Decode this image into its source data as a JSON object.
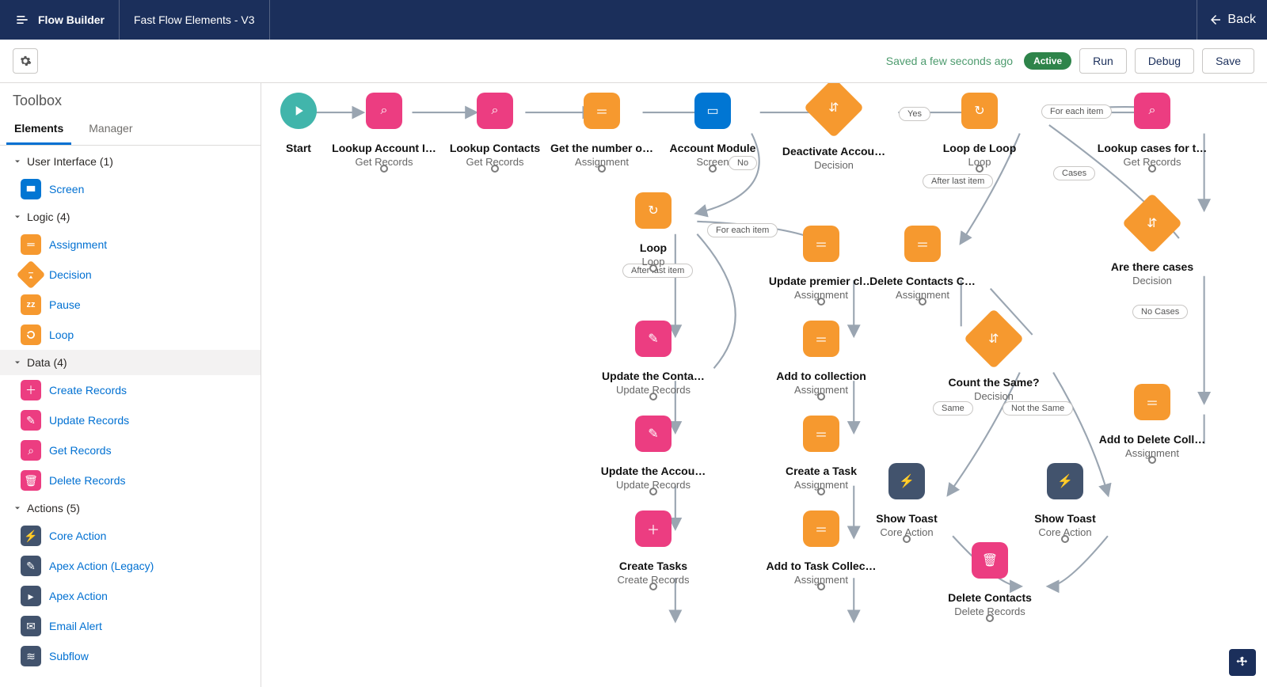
{
  "header": {
    "brand": "Flow Builder",
    "flowName": "Fast Flow Elements - V3",
    "back": "Back"
  },
  "toolbar": {
    "savedText": "Saved a few seconds ago",
    "status": "Active",
    "run": "Run",
    "debug": "Debug",
    "save": "Save"
  },
  "sidebar": {
    "title": "Toolbox",
    "tabs": {
      "elements": "Elements",
      "manager": "Manager"
    },
    "groups": {
      "ui": "User Interface (1)",
      "logic": "Logic (4)",
      "data": "Data (4)",
      "actions": "Actions (5)"
    },
    "items": {
      "screen": "Screen",
      "assignment": "Assignment",
      "decision": "Decision",
      "pause": "Pause",
      "loop": "Loop",
      "createRecords": "Create Records",
      "updateRecords": "Update Records",
      "getRecords": "Get Records",
      "deleteRecords": "Delete Records",
      "coreAction": "Core Action",
      "apexLegacy": "Apex Action (Legacy)",
      "apexAction": "Apex Action",
      "emailAlert": "Email Alert",
      "subflow": "Subflow"
    }
  },
  "nodes": {
    "start": {
      "title": "Start"
    },
    "lookupAccount": {
      "title": "Lookup Account I…",
      "sub": "Get Records"
    },
    "lookupContacts": {
      "title": "Lookup Contacts",
      "sub": "Get Records"
    },
    "getNum": {
      "title": "Get the number o…",
      "sub": "Assignment"
    },
    "accountModule": {
      "title": "Account Module",
      "sub": "Screen"
    },
    "deactivate": {
      "title": "Deactivate Accou…",
      "sub": "Decision"
    },
    "loopDeLoop": {
      "title": "Loop de Loop",
      "sub": "Loop"
    },
    "lookupCases": {
      "title": "Lookup cases for t…",
      "sub": "Get Records"
    },
    "loop": {
      "title": "Loop",
      "sub": "Loop"
    },
    "updatePremier": {
      "title": "Update premier cl…",
      "sub": "Assignment"
    },
    "deleteContactsC": {
      "title": "Delete Contacts C…",
      "sub": "Assignment"
    },
    "areThereCases": {
      "title": "Are there cases",
      "sub": "Decision"
    },
    "updateConta": {
      "title": "Update the Conta…",
      "sub": "Update Records"
    },
    "addCollection": {
      "title": "Add to collection",
      "sub": "Assignment"
    },
    "countSame": {
      "title": "Count the Same?",
      "sub": "Decision"
    },
    "updateAccou": {
      "title": "Update the Accou…",
      "sub": "Update Records"
    },
    "createTask": {
      "title": "Create a Task",
      "sub": "Assignment"
    },
    "showToast1": {
      "title": "Show Toast",
      "sub": "Core Action"
    },
    "showToast2": {
      "title": "Show Toast",
      "sub": "Core Action"
    },
    "addDeleteColl": {
      "title": "Add to Delete Coll…",
      "sub": "Assignment"
    },
    "createTasks": {
      "title": "Create Tasks",
      "sub": "Create Records"
    },
    "addTaskCollec": {
      "title": "Add to Task Collec…",
      "sub": "Assignment"
    },
    "deleteContacts": {
      "title": "Delete Contacts",
      "sub": "Delete Records"
    }
  },
  "pills": {
    "yes": "Yes",
    "no": "No",
    "forEach": "For each item",
    "afterLast": "After last item",
    "cases": "Cases",
    "noCases": "No Cases",
    "same": "Same",
    "notSame": "Not the Same"
  }
}
